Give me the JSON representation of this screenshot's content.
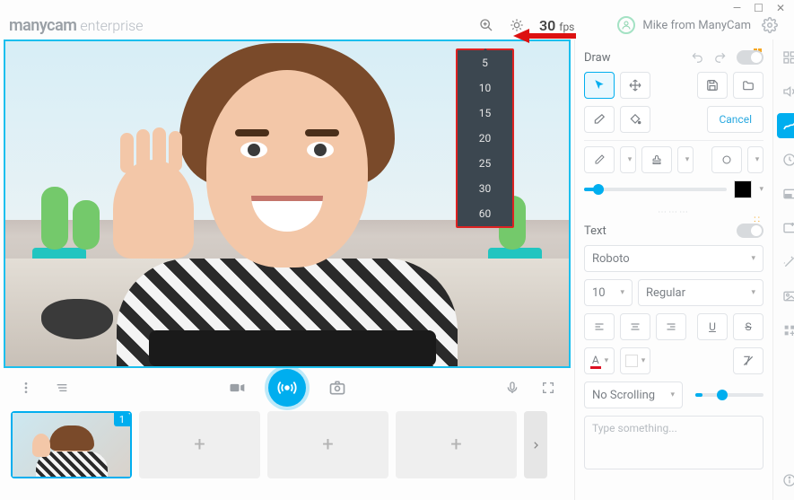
{
  "brand": {
    "part1": "manycam",
    "part2": "enterprise"
  },
  "fps": {
    "value": "30",
    "label": "fps",
    "options": [
      "5",
      "10",
      "15",
      "20",
      "25",
      "30",
      "60"
    ]
  },
  "user": {
    "name": "Mike from ManyCam"
  },
  "thumb_badge": "1",
  "draw": {
    "title": "Draw",
    "cancel": "Cancel"
  },
  "text": {
    "title": "Text",
    "font": "Roboto",
    "size": "10",
    "weight": "Regular",
    "scroll": "No Scrolling",
    "placeholder": "Type something..."
  },
  "colors": {
    "stroke": "#000000",
    "fontcolor": "#d12",
    "bg": "#ffffff"
  }
}
